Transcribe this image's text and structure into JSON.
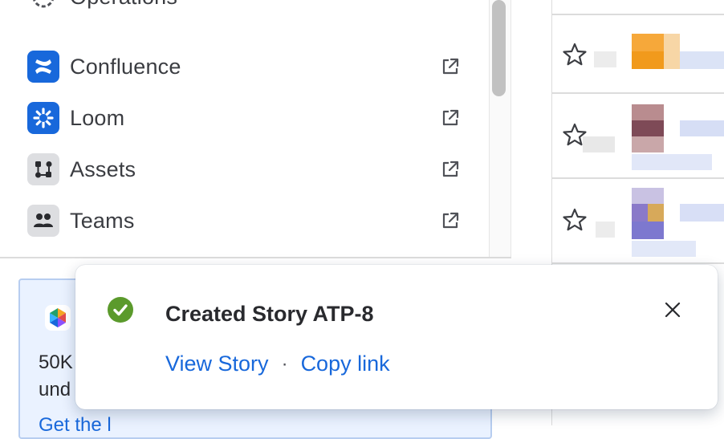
{
  "sidebar": {
    "partial_item": {
      "label": "Operations",
      "icon": "operations-icon"
    },
    "items": [
      {
        "label": "Confluence",
        "icon": "confluence-icon",
        "color": "#1868db",
        "external": true
      },
      {
        "label": "Loom",
        "icon": "loom-icon",
        "color": "#1868db",
        "external": true
      },
      {
        "label": "Assets",
        "icon": "assets-icon",
        "color": "#dddee1",
        "external": true
      },
      {
        "label": "Teams",
        "icon": "teams-icon",
        "color": "#dddee1",
        "external": true
      }
    ]
  },
  "promo": {
    "line1": "50K",
    "line2": "und",
    "link": "Get the l"
  },
  "work_items": [
    {
      "starred": false
    },
    {
      "starred": false
    },
    {
      "starred": false
    }
  ],
  "toast": {
    "title": "Created Story ATP-8",
    "primary_action": "View Story",
    "separator": "·",
    "secondary_action": "Copy link",
    "status_color": "#5b9a2c",
    "link_color": "#1868db"
  }
}
